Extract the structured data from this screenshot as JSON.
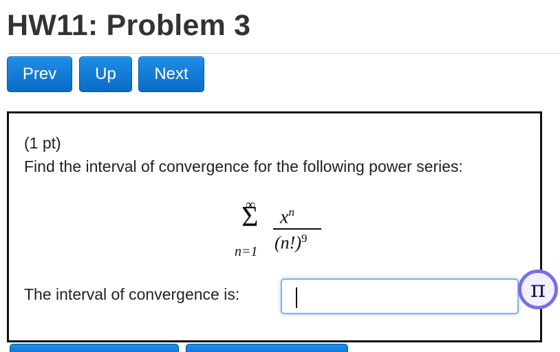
{
  "header": {
    "title": "HW11: Problem 3"
  },
  "nav": {
    "prev": "Prev",
    "up": "Up",
    "next": "Next"
  },
  "problem": {
    "points": "(1 pt)",
    "prompt": "Find the interval of convergence for the following power series:",
    "formula": {
      "sum_upper": "∞",
      "sigma": "Σ",
      "sum_lower": "n=1",
      "numerator_base": "x",
      "numerator_exp": "n",
      "denominator_base": "(n!)",
      "denominator_exp": "9"
    },
    "answer_label": "The interval of convergence is:",
    "answer_value": ""
  },
  "tools": {
    "pi_symbol": "π"
  },
  "colors": {
    "button_blue": "#0a6cc7",
    "input_focus": "#7fb4ea",
    "pi_ring": "#7a6ee6"
  }
}
